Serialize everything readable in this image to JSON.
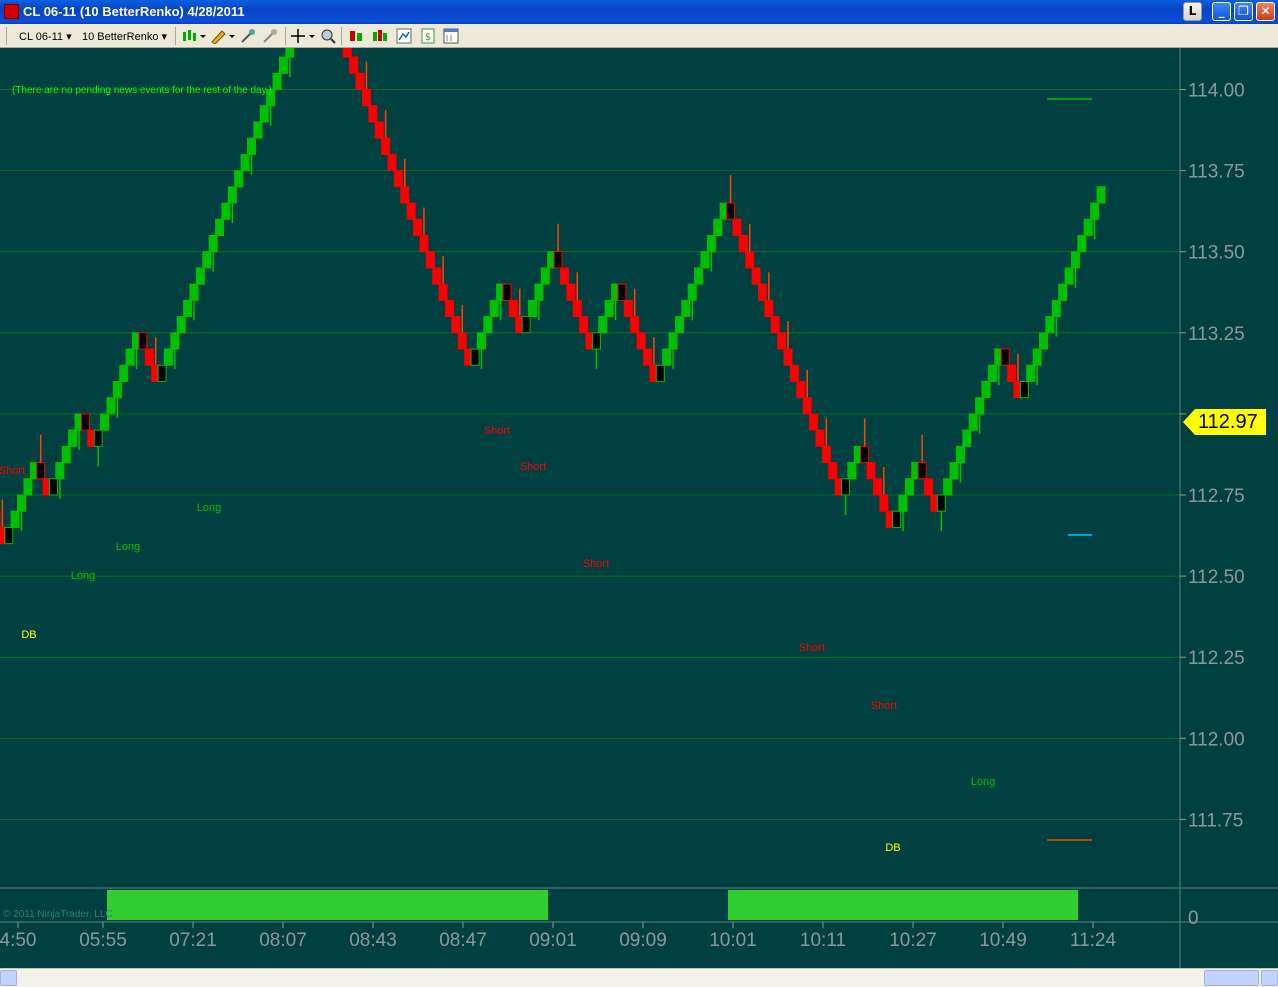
{
  "window": {
    "title": "CL 06-11 (10 BetterRenko)  4/28/2011",
    "buttons": {
      "l": "L",
      "minimize": "_",
      "maximize": "❐",
      "close": "✕"
    }
  },
  "toolbar": {
    "instrument": "CL 06-11",
    "period": "10 BetterRenko",
    "icons": [
      "bar-style-icon",
      "drawing-pencil-icon",
      "drawing-tools-icon",
      "crosshair-icon",
      "zoom-icon",
      "data-box-icon",
      "indicators-icon",
      "strategies-icon",
      "chart-properties-icon",
      "properties-icon"
    ]
  },
  "colors": {
    "background": "#004040",
    "up_bar": "#00c000",
    "down_bar": "#ff0000",
    "wick_up": "#00c000",
    "wick_down": "#ff4500",
    "gridline": "#00a000",
    "price_marker": "#ffff00",
    "signal_short": "#ff0000",
    "signal_long": "#00c000",
    "signal_db": "#ffff00",
    "news_text": "#00ff00",
    "volume_band": "#32cd32"
  },
  "chart": {
    "news_message": "(There are no pending news events for the rest of the day.)",
    "copyright": "© 2011 NinjaTrader, LLC",
    "current_price": "112.97",
    "lower_panel_label": "0"
  },
  "chart_data": {
    "type": "renko",
    "instrument": "CL 06-11",
    "brick_size": 0.05,
    "y_ticks": [
      111.75,
      112.0,
      112.25,
      112.5,
      112.75,
      113.0,
      113.25,
      113.5,
      113.75,
      114.0
    ],
    "y_tick_labels": [
      "111.75",
      "112.00",
      "112.25",
      "112.50",
      "112.75",
      "",
      "113.25",
      "113.50",
      "113.75",
      "114.00"
    ],
    "x_tick_labels": [
      "4:50",
      "05:55",
      "07:21",
      "08:07",
      "08:43",
      "08:47",
      "09:01",
      "09:09",
      "10:01",
      "10:11",
      "10:27",
      "10:49",
      "11:24"
    ],
    "last_price": 112.97,
    "closes_start": 112.7,
    "brick_directions": "DDUUUUUDDUUUUUDDUUUUUUUDDDUUUUUUUUUUUUUUUUUUUUUUUUUDDDDDDDDDDDDDDDDDDDDDDDDUUUUUDDDUUUUUDDDDDDUUUUDDDDDDUUUUUUUUUUUDDDDDDDDDDDDDDDDDDUUUDDDDDUUUUDDDUUUUUUUUUUDDDUUUUUUUUUUUUU",
    "signals": [
      {
        "text": "Short",
        "kind": "short"
      },
      {
        "text": "DB",
        "kind": "db"
      },
      {
        "text": "Long",
        "kind": "long"
      },
      {
        "text": "Long",
        "kind": "long"
      },
      {
        "text": "Long",
        "kind": "long"
      },
      {
        "text": "Short",
        "kind": "short"
      },
      {
        "text": "Short",
        "kind": "short"
      },
      {
        "text": "Short",
        "kind": "short"
      },
      {
        "text": "Short",
        "kind": "short"
      },
      {
        "text": "Short",
        "kind": "short"
      },
      {
        "text": "DB",
        "kind": "db"
      },
      {
        "text": "Long",
        "kind": "long"
      }
    ]
  }
}
